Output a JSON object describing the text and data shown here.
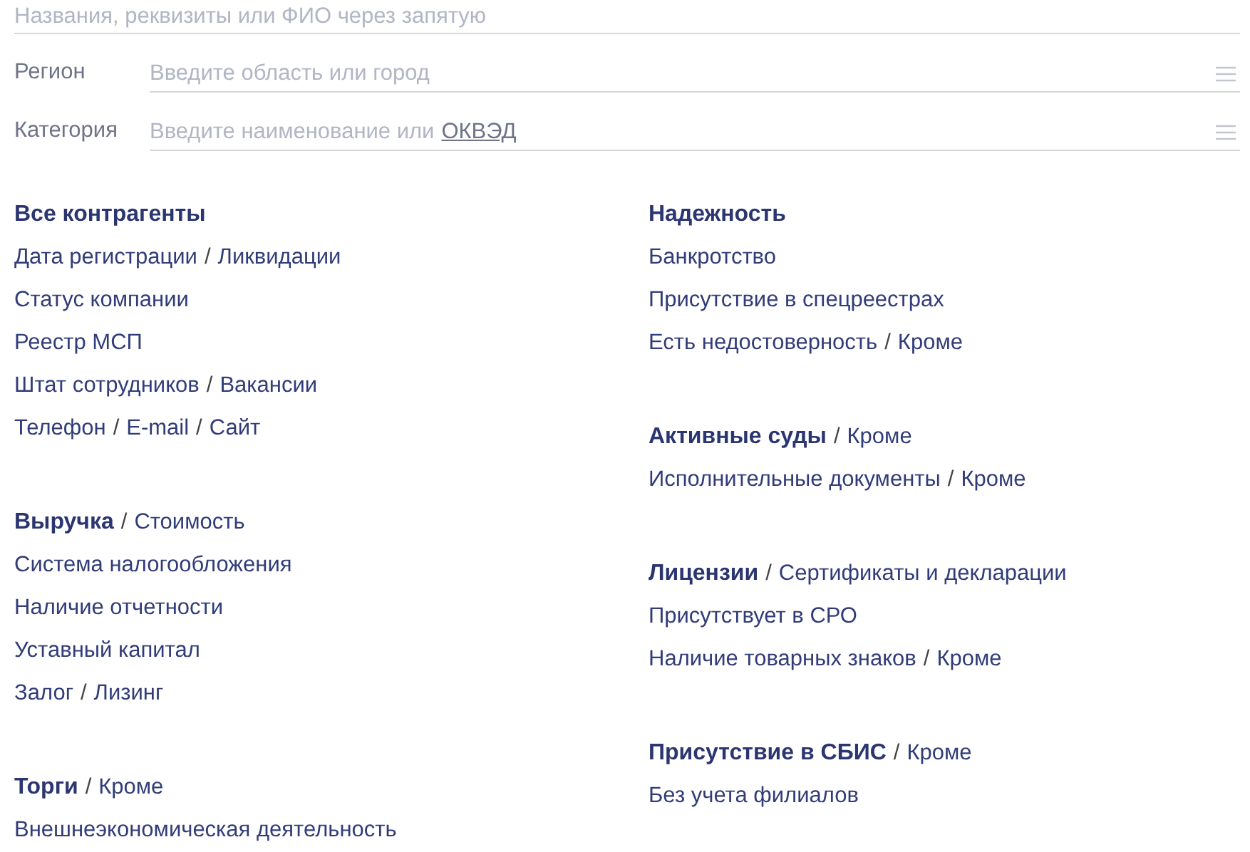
{
  "search": {
    "placeholder": "Названия, реквизиты или ФИО через запятую"
  },
  "filters": [
    {
      "label": "Регион",
      "placeholder": "Введите область или город"
    },
    {
      "label": "Категория",
      "placeholder": "Введите наименование или",
      "placeholder_link": "ОКВЭД"
    }
  ],
  "columns": [
    [
      {
        "title": [
          "Все контрагенты"
        ],
        "items": [
          [
            "Дата регистрации",
            "Ликвидации"
          ],
          [
            "Статус компании"
          ],
          [
            "Реестр МСП"
          ],
          [
            "Штат сотрудников",
            "Вакансии"
          ],
          [
            "Телефон",
            "E-mail",
            "Сайт"
          ]
        ]
      },
      {
        "title": [
          "Выручка",
          "Стоимость"
        ],
        "items": [
          [
            "Система налогообложения"
          ],
          [
            "Наличие отчетности"
          ],
          [
            "Уставный капитал"
          ],
          [
            "Залог",
            "Лизинг"
          ]
        ]
      },
      {
        "title": [
          "Торги",
          "Кроме"
        ],
        "items": [
          [
            "Внешнеэкономическая деятельность"
          ]
        ]
      }
    ],
    [
      {
        "title": [
          "Надежность"
        ],
        "items": [
          [
            "Банкротство"
          ],
          [
            "Присутствие в спецреестрах"
          ],
          [
            "Есть недостоверность",
            "Кроме"
          ]
        ]
      },
      {
        "title": [
          "Активные суды",
          "Кроме"
        ],
        "items": [
          [
            "Исполнительные документы",
            "Кроме"
          ]
        ]
      },
      {
        "title": [
          "Лицензии",
          "Сертификаты и декларации"
        ],
        "items": [
          [
            "Присутствует в СРО"
          ],
          [
            "Наличие товарных знаков",
            "Кроме"
          ]
        ]
      },
      {
        "title": [
          "Присутствие в СБИС",
          "Кроме"
        ],
        "items": [
          [
            "Без учета филиалов"
          ]
        ]
      }
    ]
  ],
  "separator": "/"
}
